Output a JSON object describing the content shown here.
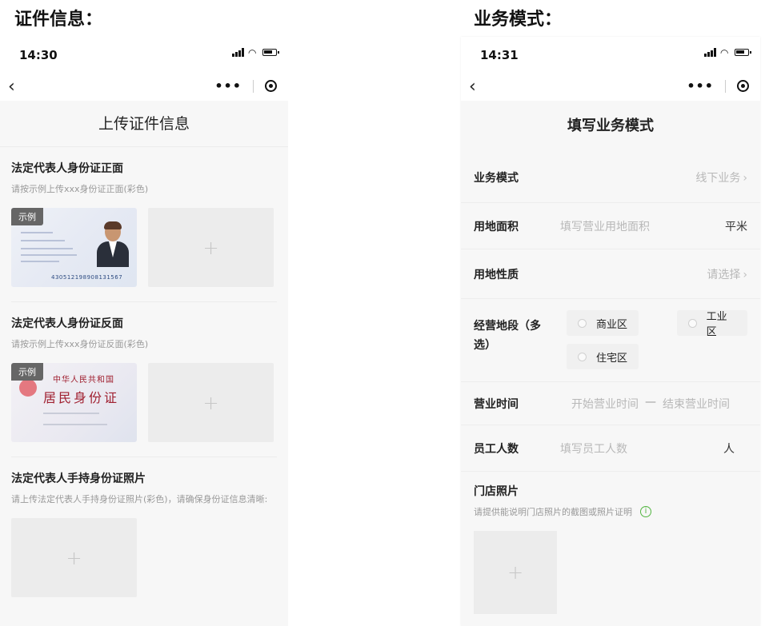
{
  "left_section": {
    "heading": "证件信息：",
    "status_time": "14:30",
    "back_glyph": "‹",
    "more_glyph": "•••",
    "page_title": "上传证件信息",
    "blocks": [
      {
        "title": "法定代表人身份证正面",
        "desc": "请按示例上传xxx身份证正面(彩色)",
        "sample_tag": "示例"
      },
      {
        "title": "法定代表人身份证反面",
        "desc": "请按示例上传xxx身份证反面(彩色)",
        "sample_tag": "示例"
      },
      {
        "title": "法定代表人手持身份证照片",
        "desc": "请上传法定代表人手持身份证照片(彩色)，请确保身份证信息清晰:"
      }
    ],
    "front_card": {
      "id_number": "430512198908131567"
    },
    "back_card": {
      "title_small": "中华人民共和国",
      "title_big": "居民身份证"
    },
    "plus_glyph": "+"
  },
  "right_section": {
    "heading": "业务模式：",
    "status_time": "14:31",
    "back_glyph": "‹",
    "more_glyph": "•••",
    "page_title": "填写业务模式",
    "rows": {
      "business_mode": {
        "label": "业务模式",
        "value": "线下业务"
      },
      "land_area": {
        "label": "用地面积",
        "placeholder": "填写营业用地面积",
        "unit": "平米"
      },
      "land_nature": {
        "label": "用地性质",
        "value": "请选择"
      },
      "location": {
        "label": "经营地段（多选）",
        "options": [
          "商业区",
          "工业区",
          "住宅区"
        ]
      },
      "hours": {
        "label": "营业时间",
        "start": "开始营业时间",
        "sep": "—",
        "end": "结束营业时间"
      },
      "staff": {
        "label": "员工人数",
        "placeholder": "填写员工人数",
        "unit": "人"
      }
    },
    "store": {
      "title": "门店照片",
      "desc": "请提供能说明门店照片的截图或照片证明",
      "info_glyph": "i"
    },
    "chevron_glyph": "›",
    "plus_glyph": "+"
  }
}
